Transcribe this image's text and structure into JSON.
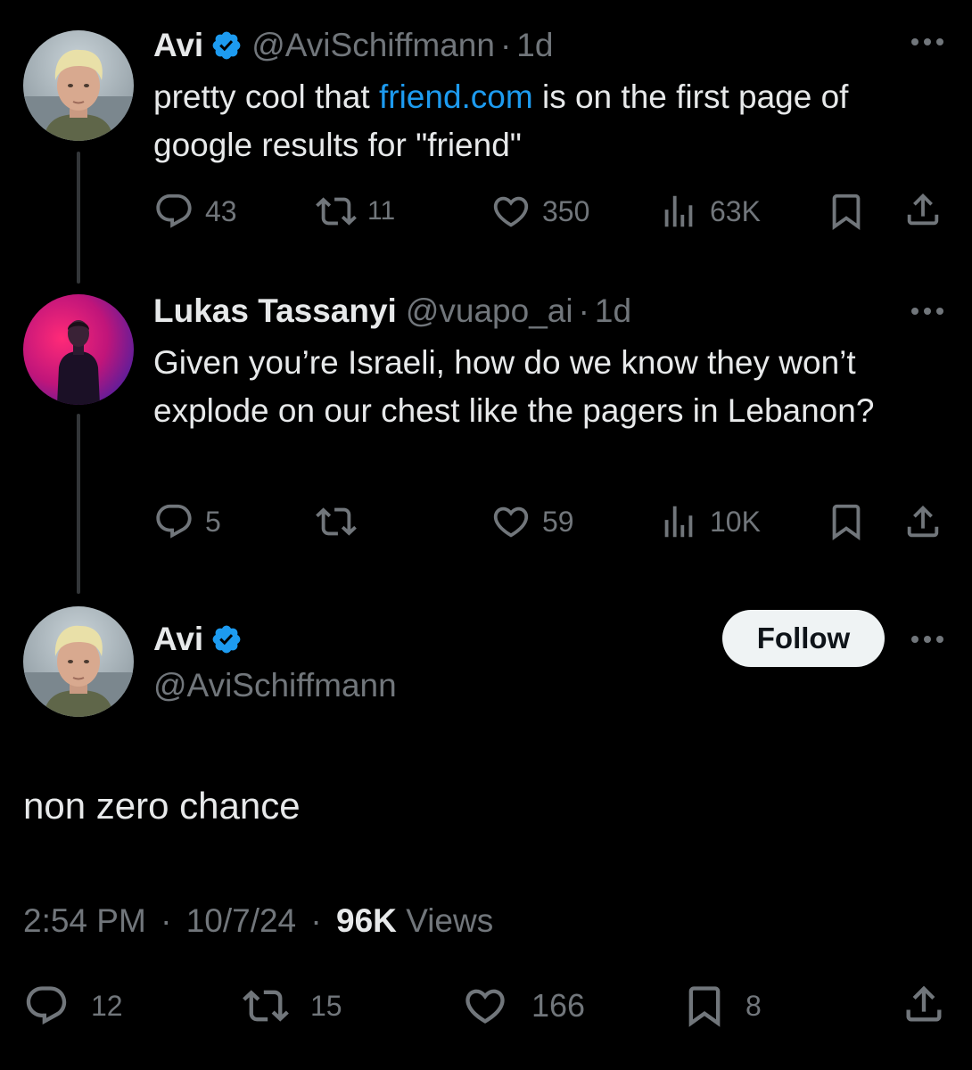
{
  "tweets": [
    {
      "name": "Avi",
      "handle": "@AviSchiffmann",
      "sep": "·",
      "age": "1d",
      "text_before": "pretty cool that ",
      "link": "friend.com",
      "text_after": " is on the first page of google results for \"friend\"",
      "replies": "43",
      "retweets": "11",
      "likes": "350",
      "views": "63K"
    },
    {
      "name": "Lukas Tassanyi",
      "handle": "@vuapo_ai",
      "sep": "·",
      "age": "1d",
      "text": "Given you’re Israeli, how do we know they won’t explode on our chest like the pagers in Lebanon?",
      "replies": "5",
      "retweets": "",
      "likes": "59",
      "views": "10K"
    }
  ],
  "main": {
    "name": "Avi",
    "handle": "@AviSchiffmann",
    "follow_label": "Follow",
    "text": "non zero chance",
    "time": "2:54 PM",
    "sep1": "·",
    "date": "10/7/24",
    "sep2": "·",
    "views_count": "96K",
    "views_label": "Views",
    "replies": "12",
    "retweets": "15",
    "likes": "166",
    "bookmarks": "8"
  },
  "colors": {
    "background": "#000000",
    "text": "#e7e9ea",
    "secondary": "#71767b",
    "link": "#1d9bf0",
    "verified": "#1d9bf0"
  },
  "icons": [
    "verified-badge-icon",
    "more-options-icon",
    "reply-icon",
    "retweet-icon",
    "like-icon",
    "views-icon",
    "bookmark-icon",
    "share-icon"
  ]
}
